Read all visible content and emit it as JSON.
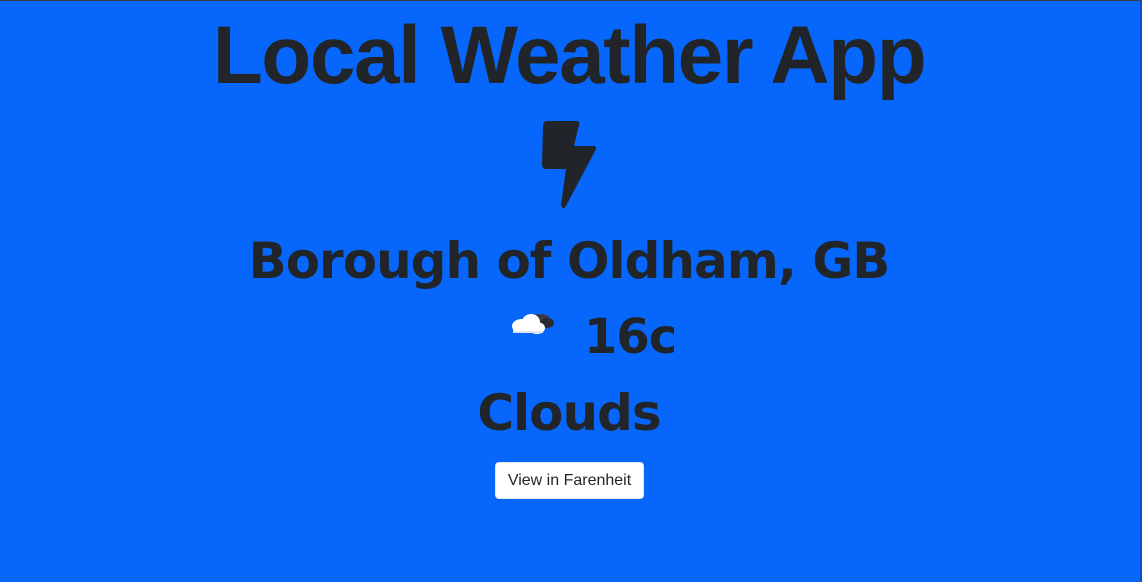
{
  "app": {
    "title": "Local Weather App"
  },
  "weather": {
    "main_icon": "lightning-bolt-icon",
    "location": "Borough of Oldham, GB",
    "condition_icon": "cloud-icon",
    "temperature": "16c",
    "conditions": "Clouds"
  },
  "controls": {
    "toggle_unit_label": "View in Farenheit"
  },
  "colors": {
    "background": "#0767fc",
    "text": "#212529",
    "button_background": "#ffffff"
  }
}
